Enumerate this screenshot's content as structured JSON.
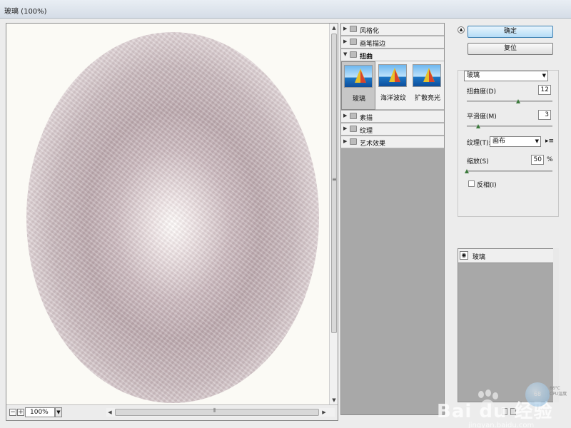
{
  "window": {
    "title": "玻璃 (100%)"
  },
  "preview": {
    "zoom": "100%"
  },
  "gallery": {
    "categories_top": [
      {
        "label": "风格化",
        "expanded": false
      },
      {
        "label": "画笔描边",
        "expanded": false
      },
      {
        "label": "扭曲",
        "expanded": true
      }
    ],
    "thumbnails": [
      {
        "label": "玻璃",
        "selected": true
      },
      {
        "label": "海洋波纹",
        "selected": false
      },
      {
        "label": "扩散亮光",
        "selected": false
      }
    ],
    "categories_bottom": [
      {
        "label": "素描",
        "expanded": false
      },
      {
        "label": "纹理",
        "expanded": false
      },
      {
        "label": "艺术效果",
        "expanded": false
      }
    ]
  },
  "buttons": {
    "ok": "确定",
    "reset": "复位"
  },
  "settings": {
    "filter_select": "玻璃",
    "distortion": {
      "label": "扭曲度(D)",
      "value": "12",
      "fraction": 0.6
    },
    "smoothness": {
      "label": "平滑度(M)",
      "value": "3",
      "fraction": 0.13
    },
    "texture": {
      "label": "纹理(T):",
      "value": "画布"
    },
    "scaling": {
      "label": "缩放(S)",
      "value": "50",
      "unit": "%",
      "fraction": 0.0
    },
    "invert": {
      "label": "反相(I)",
      "checked": false
    }
  },
  "layers": [
    {
      "name": "玻璃"
    }
  ],
  "watermark": {
    "brand": "Bai du 经验",
    "url": "jingyan.baidu.com"
  },
  "gadget": {
    "value": "68",
    "side_line1": "66°C",
    "side_line2": "CPU温度"
  }
}
